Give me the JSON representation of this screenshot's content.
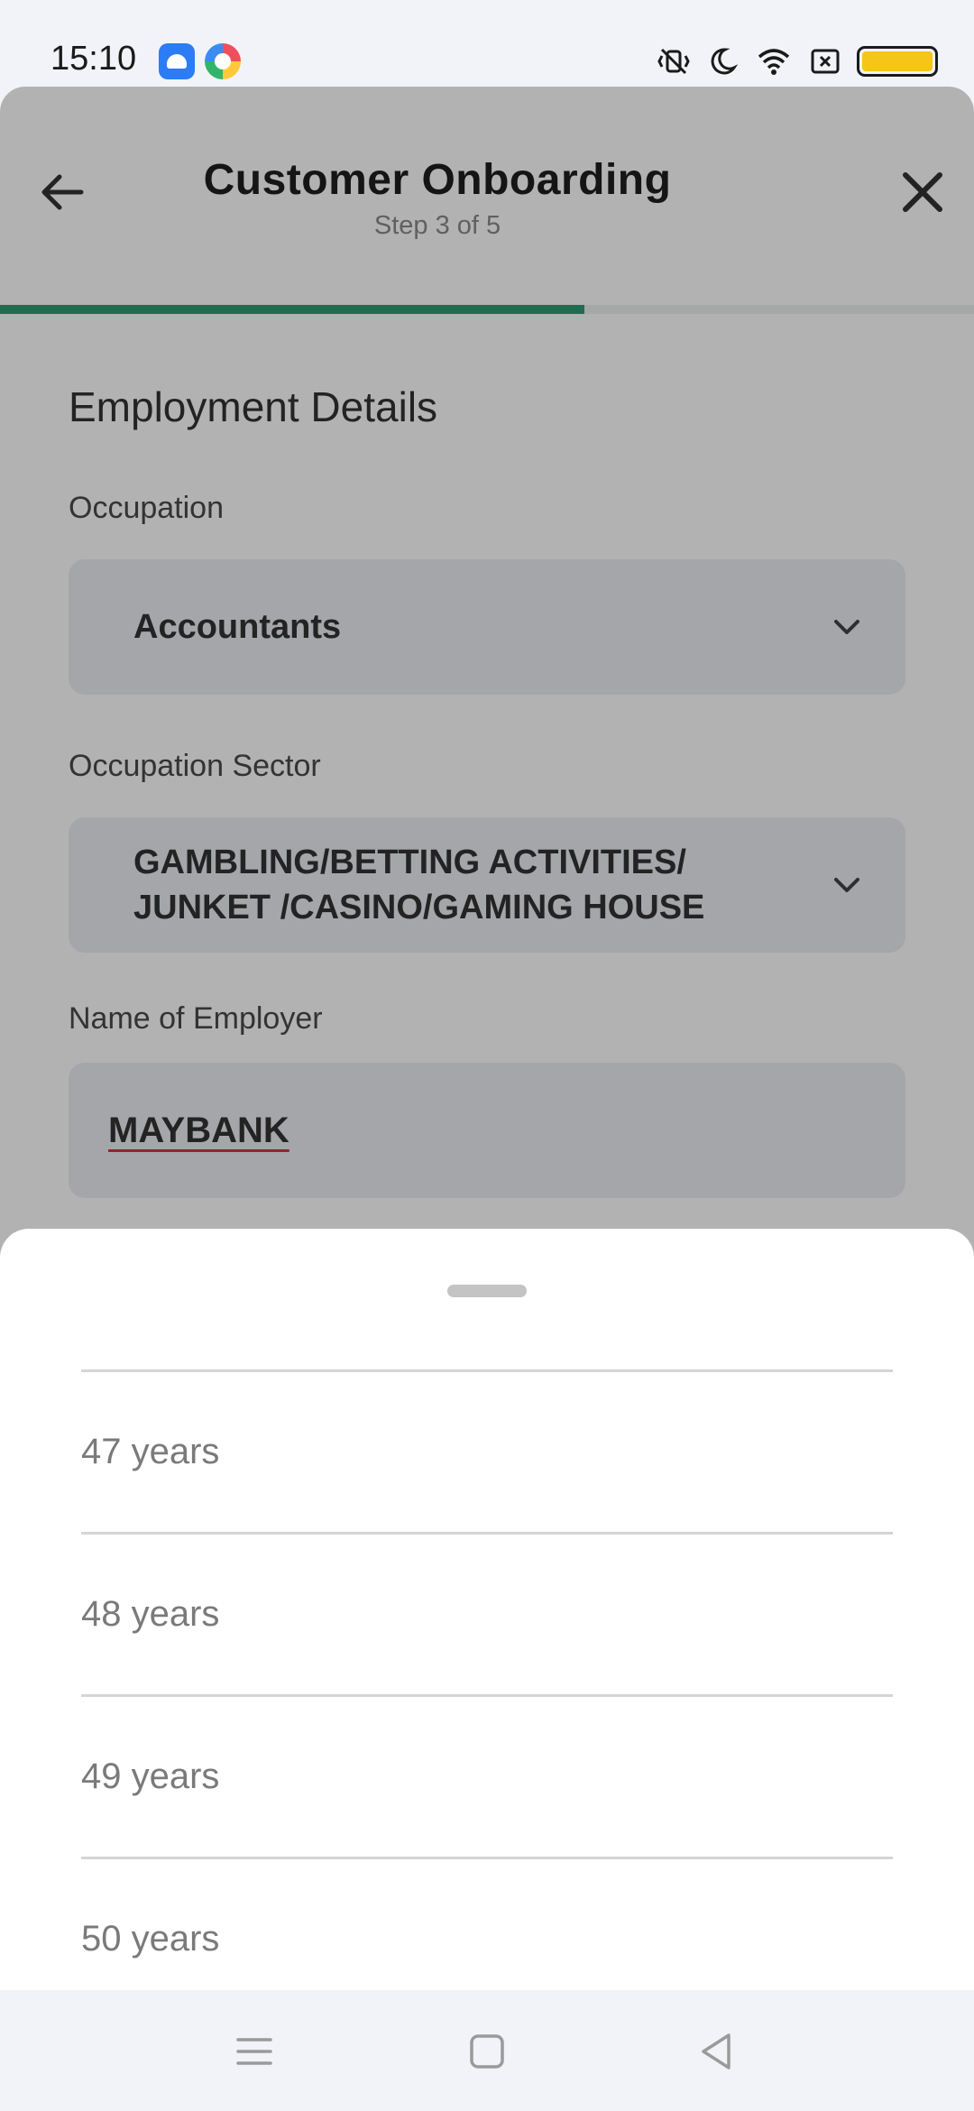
{
  "status_bar": {
    "time": "15:10",
    "icons": [
      "android-app-icon",
      "browser-app-icon",
      "vibrate-icon",
      "moon-icon",
      "wifi-icon",
      "sim-icon",
      "battery-icon"
    ],
    "battery_color": "#f5c518"
  },
  "header": {
    "title": "Customer Onboarding",
    "subtitle": "Step 3 of 5",
    "progress_fraction": 0.6,
    "progress_color": "#2e9b75",
    "back_icon": "arrow-left-icon",
    "close_icon": "close-icon"
  },
  "form": {
    "section_title": "Employment Details",
    "occupation": {
      "label": "Occupation",
      "value": "Accountants"
    },
    "occupation_sector": {
      "label": "Occupation Sector",
      "value": "GAMBLING/BETTING ACTIVITIES/ JUNKET /CASINO/GAMING HOUSE"
    },
    "employer": {
      "label": "Name of Employer",
      "value": "MAYBANK"
    }
  },
  "sheet": {
    "options": [
      {
        "label": "47 years"
      },
      {
        "label": "48 years"
      },
      {
        "label": "49 years"
      },
      {
        "label": "50 years"
      }
    ]
  },
  "nav": {
    "icons": [
      "menu-icon",
      "home-icon",
      "back-icon"
    ]
  }
}
